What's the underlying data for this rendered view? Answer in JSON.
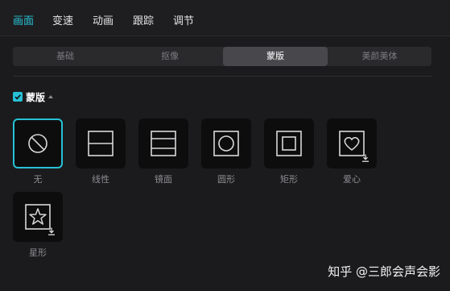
{
  "tabs": [
    {
      "label": "画面",
      "active": true
    },
    {
      "label": "变速",
      "active": false
    },
    {
      "label": "动画",
      "active": false
    },
    {
      "label": "跟踪",
      "active": false
    },
    {
      "label": "调节",
      "active": false
    }
  ],
  "subtabs": [
    {
      "label": "基础",
      "active": false
    },
    {
      "label": "抠像",
      "active": false
    },
    {
      "label": "蒙版",
      "active": true
    },
    {
      "label": "美颜美体",
      "active": false
    }
  ],
  "mask": {
    "title": "蒙版",
    "checked": true,
    "items": [
      {
        "label": "无",
        "icon": "none-icon",
        "selected": true,
        "download": false
      },
      {
        "label": "线性",
        "icon": "linear-mask-icon",
        "selected": false,
        "download": false
      },
      {
        "label": "镜面",
        "icon": "mirror-mask-icon",
        "selected": false,
        "download": false
      },
      {
        "label": "圆形",
        "icon": "circle-mask-icon",
        "selected": false,
        "download": false
      },
      {
        "label": "矩形",
        "icon": "rectangle-mask-icon",
        "selected": false,
        "download": false
      },
      {
        "label": "爱心",
        "icon": "heart-mask-icon",
        "selected": false,
        "download": true
      },
      {
        "label": "星形",
        "icon": "star-mask-icon",
        "selected": false,
        "download": true
      }
    ]
  },
  "watermark": "知乎 @三郎会声会影",
  "colors": {
    "accent": "#27c1d6",
    "background": "#1b1b1d",
    "tile": "#0d0d0e"
  }
}
